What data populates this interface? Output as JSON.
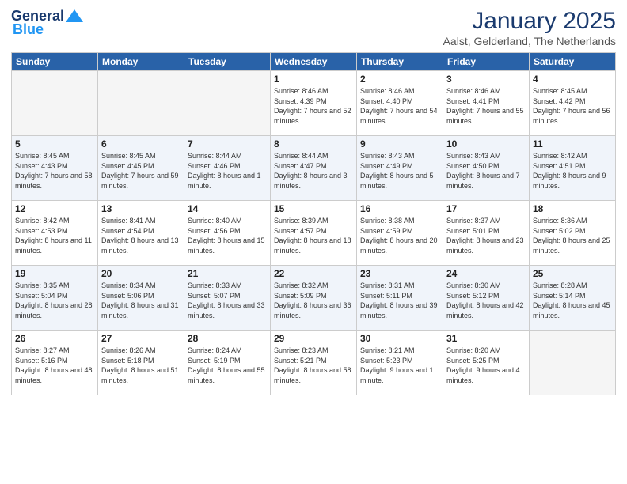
{
  "header": {
    "logo_general": "General",
    "logo_blue": "Blue",
    "month_title": "January 2025",
    "subtitle": "Aalst, Gelderland, The Netherlands"
  },
  "days_of_week": [
    "Sunday",
    "Monday",
    "Tuesday",
    "Wednesday",
    "Thursday",
    "Friday",
    "Saturday"
  ],
  "weeks": [
    [
      {
        "day": "",
        "info": ""
      },
      {
        "day": "",
        "info": ""
      },
      {
        "day": "",
        "info": ""
      },
      {
        "day": "1",
        "info": "Sunrise: 8:46 AM\nSunset: 4:39 PM\nDaylight: 7 hours and 52 minutes."
      },
      {
        "day": "2",
        "info": "Sunrise: 8:46 AM\nSunset: 4:40 PM\nDaylight: 7 hours and 54 minutes."
      },
      {
        "day": "3",
        "info": "Sunrise: 8:46 AM\nSunset: 4:41 PM\nDaylight: 7 hours and 55 minutes."
      },
      {
        "day": "4",
        "info": "Sunrise: 8:45 AM\nSunset: 4:42 PM\nDaylight: 7 hours and 56 minutes."
      }
    ],
    [
      {
        "day": "5",
        "info": "Sunrise: 8:45 AM\nSunset: 4:43 PM\nDaylight: 7 hours and 58 minutes."
      },
      {
        "day": "6",
        "info": "Sunrise: 8:45 AM\nSunset: 4:45 PM\nDaylight: 7 hours and 59 minutes."
      },
      {
        "day": "7",
        "info": "Sunrise: 8:44 AM\nSunset: 4:46 PM\nDaylight: 8 hours and 1 minute."
      },
      {
        "day": "8",
        "info": "Sunrise: 8:44 AM\nSunset: 4:47 PM\nDaylight: 8 hours and 3 minutes."
      },
      {
        "day": "9",
        "info": "Sunrise: 8:43 AM\nSunset: 4:49 PM\nDaylight: 8 hours and 5 minutes."
      },
      {
        "day": "10",
        "info": "Sunrise: 8:43 AM\nSunset: 4:50 PM\nDaylight: 8 hours and 7 minutes."
      },
      {
        "day": "11",
        "info": "Sunrise: 8:42 AM\nSunset: 4:51 PM\nDaylight: 8 hours and 9 minutes."
      }
    ],
    [
      {
        "day": "12",
        "info": "Sunrise: 8:42 AM\nSunset: 4:53 PM\nDaylight: 8 hours and 11 minutes."
      },
      {
        "day": "13",
        "info": "Sunrise: 8:41 AM\nSunset: 4:54 PM\nDaylight: 8 hours and 13 minutes."
      },
      {
        "day": "14",
        "info": "Sunrise: 8:40 AM\nSunset: 4:56 PM\nDaylight: 8 hours and 15 minutes."
      },
      {
        "day": "15",
        "info": "Sunrise: 8:39 AM\nSunset: 4:57 PM\nDaylight: 8 hours and 18 minutes."
      },
      {
        "day": "16",
        "info": "Sunrise: 8:38 AM\nSunset: 4:59 PM\nDaylight: 8 hours and 20 minutes."
      },
      {
        "day": "17",
        "info": "Sunrise: 8:37 AM\nSunset: 5:01 PM\nDaylight: 8 hours and 23 minutes."
      },
      {
        "day": "18",
        "info": "Sunrise: 8:36 AM\nSunset: 5:02 PM\nDaylight: 8 hours and 25 minutes."
      }
    ],
    [
      {
        "day": "19",
        "info": "Sunrise: 8:35 AM\nSunset: 5:04 PM\nDaylight: 8 hours and 28 minutes."
      },
      {
        "day": "20",
        "info": "Sunrise: 8:34 AM\nSunset: 5:06 PM\nDaylight: 8 hours and 31 minutes."
      },
      {
        "day": "21",
        "info": "Sunrise: 8:33 AM\nSunset: 5:07 PM\nDaylight: 8 hours and 33 minutes."
      },
      {
        "day": "22",
        "info": "Sunrise: 8:32 AM\nSunset: 5:09 PM\nDaylight: 8 hours and 36 minutes."
      },
      {
        "day": "23",
        "info": "Sunrise: 8:31 AM\nSunset: 5:11 PM\nDaylight: 8 hours and 39 minutes."
      },
      {
        "day": "24",
        "info": "Sunrise: 8:30 AM\nSunset: 5:12 PM\nDaylight: 8 hours and 42 minutes."
      },
      {
        "day": "25",
        "info": "Sunrise: 8:28 AM\nSunset: 5:14 PM\nDaylight: 8 hours and 45 minutes."
      }
    ],
    [
      {
        "day": "26",
        "info": "Sunrise: 8:27 AM\nSunset: 5:16 PM\nDaylight: 8 hours and 48 minutes."
      },
      {
        "day": "27",
        "info": "Sunrise: 8:26 AM\nSunset: 5:18 PM\nDaylight: 8 hours and 51 minutes."
      },
      {
        "day": "28",
        "info": "Sunrise: 8:24 AM\nSunset: 5:19 PM\nDaylight: 8 hours and 55 minutes."
      },
      {
        "day": "29",
        "info": "Sunrise: 8:23 AM\nSunset: 5:21 PM\nDaylight: 8 hours and 58 minutes."
      },
      {
        "day": "30",
        "info": "Sunrise: 8:21 AM\nSunset: 5:23 PM\nDaylight: 9 hours and 1 minute."
      },
      {
        "day": "31",
        "info": "Sunrise: 8:20 AM\nSunset: 5:25 PM\nDaylight: 9 hours and 4 minutes."
      },
      {
        "day": "",
        "info": ""
      }
    ]
  ]
}
